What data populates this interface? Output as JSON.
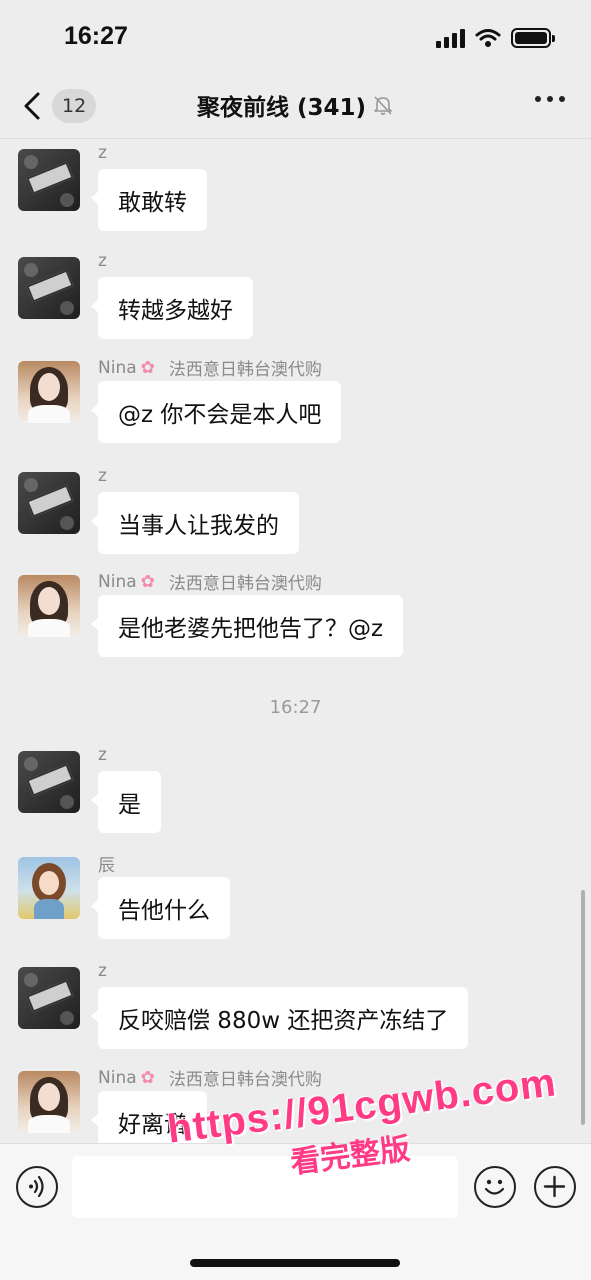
{
  "status_bar": {
    "time": "16:27"
  },
  "nav": {
    "unread_count": "12",
    "title": "聚夜前线 (341)"
  },
  "messages": [
    {
      "sender": "z",
      "text": "敢敢转"
    },
    {
      "sender": "z",
      "text": "转越多越好"
    },
    {
      "sender": "Nina",
      "tag": "法西意日韩台澳代购",
      "text": "@z 你不会是本人吧"
    },
    {
      "sender": "z",
      "text": "当事人让我发的"
    },
    {
      "sender": "Nina",
      "tag": "法西意日韩台澳代购",
      "text": "是他老婆先把他告了？@z"
    },
    {
      "sender": "z",
      "text": "是"
    },
    {
      "sender": "辰",
      "text": "告他什么"
    },
    {
      "sender": "z",
      "text": "反咬赔偿 880w 还把资产冻结了"
    },
    {
      "sender": "Nina",
      "tag": "法西意日韩台澳代购",
      "text": "好离谱"
    }
  ],
  "timestamp": "16:27",
  "input": {
    "placeholder": ""
  },
  "watermark": {
    "url": "https://91cgwb.com",
    "subtitle": "看完整版"
  },
  "icons": [
    "back-chevron-icon",
    "mute-bell-icon",
    "more-dots-icon",
    "voice-icon",
    "emoji-icon",
    "plus-icon",
    "signal-icon",
    "wifi-icon",
    "battery-icon",
    "flower-icon"
  ],
  "colors": {
    "background": "#ededed",
    "bubble": "#ffffff",
    "watermark": "#ff3b86",
    "sender": "#8a8a8a"
  }
}
